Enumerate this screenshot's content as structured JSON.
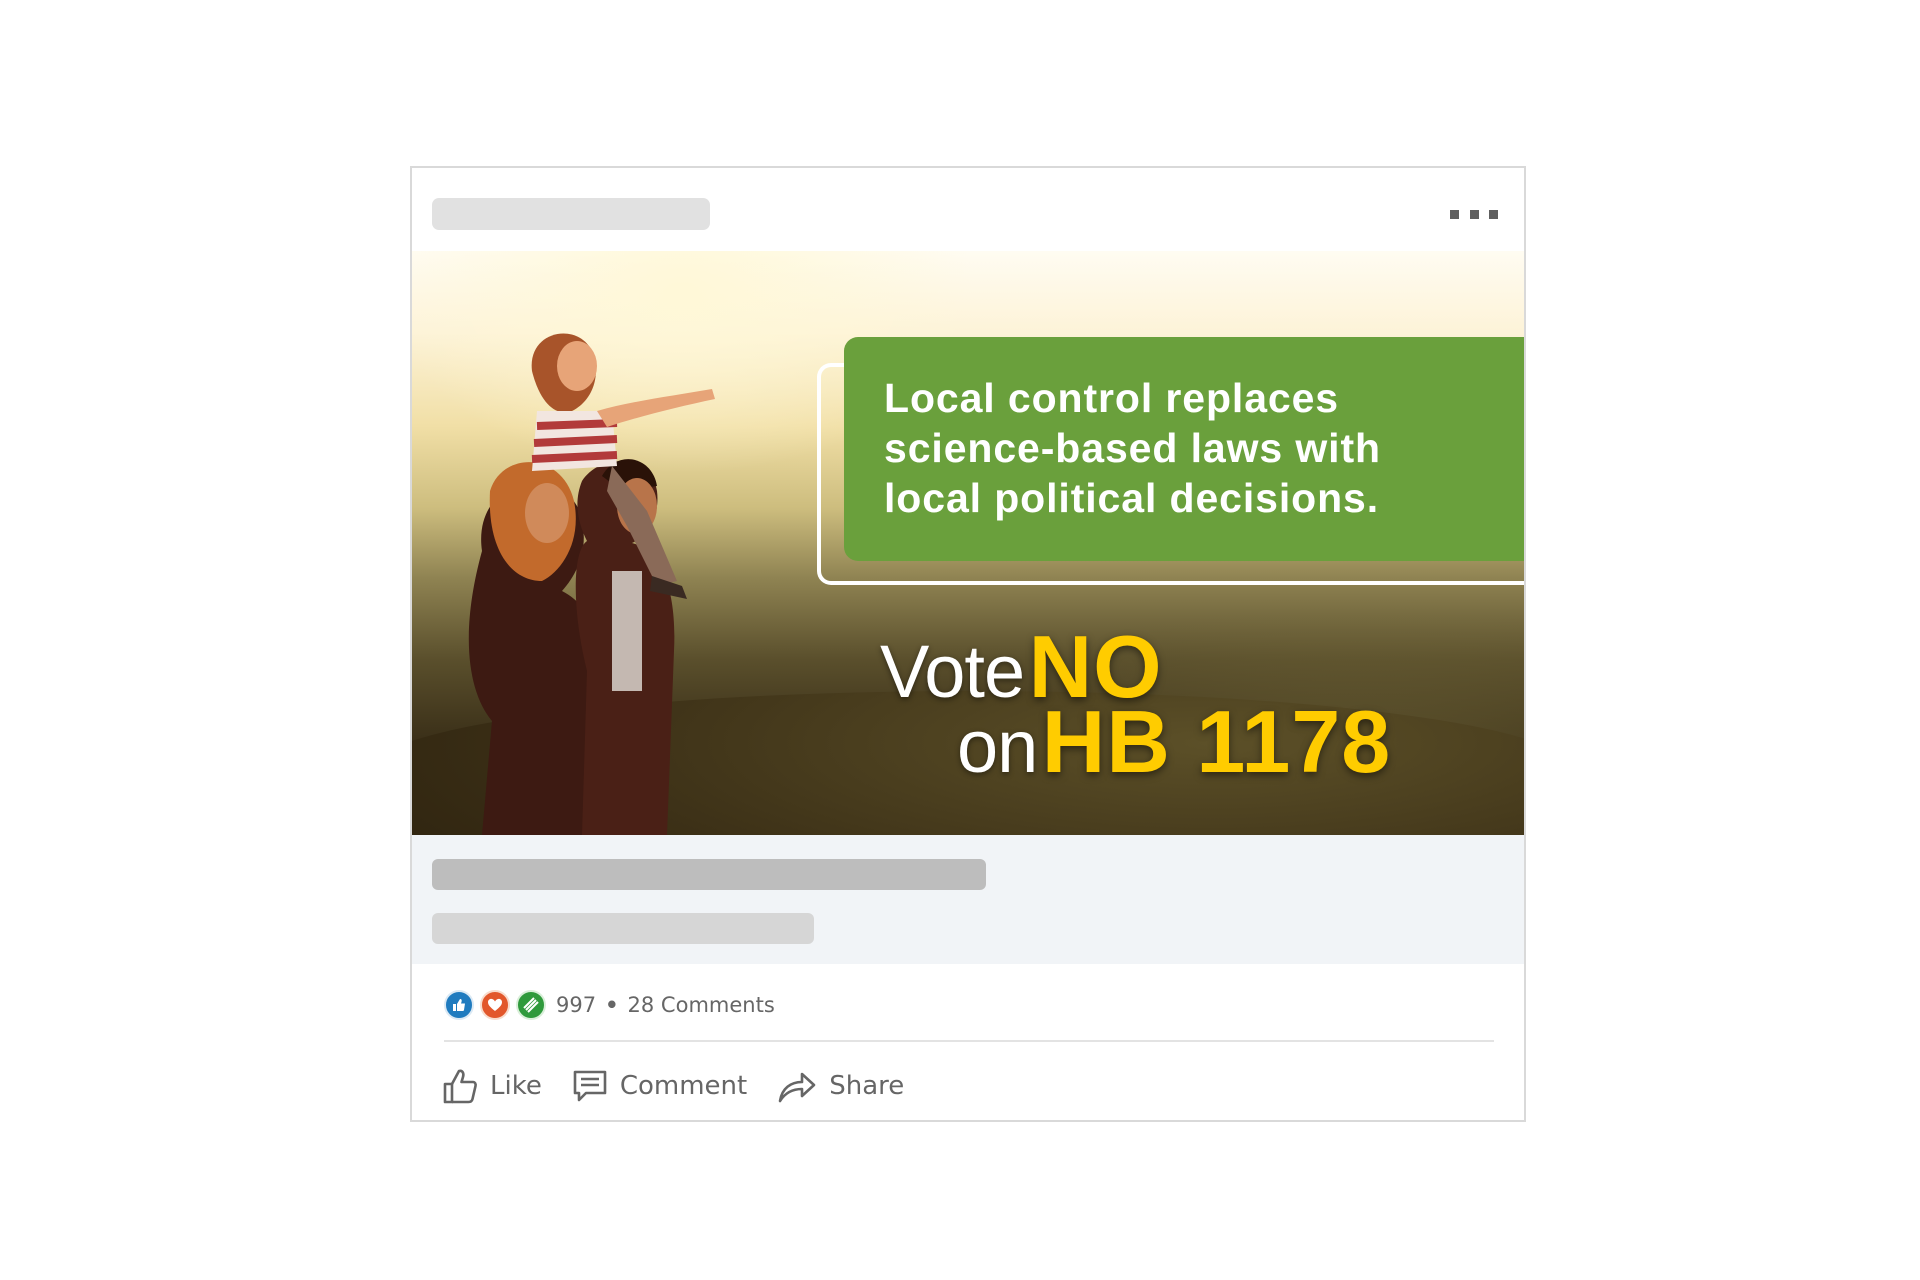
{
  "post": {
    "menu_icon": "more-horizontal-icon",
    "ad": {
      "headline_lines": [
        "Local control replaces",
        "science-based laws with",
        "local political decisions."
      ],
      "vote_word": "Vote",
      "no_word": "NO",
      "on_word": "on",
      "bill": "HB 1178",
      "colors": {
        "headline_box": "#6aa03c",
        "highlight": "#ffcc00"
      }
    },
    "social": {
      "reaction_icons": [
        "like-icon",
        "love-icon",
        "insightful-icon"
      ],
      "reaction_count": "997",
      "separator": "•",
      "comments": "28 Comments"
    },
    "actions": {
      "like": "Like",
      "comment": "Comment",
      "share": "Share"
    }
  }
}
